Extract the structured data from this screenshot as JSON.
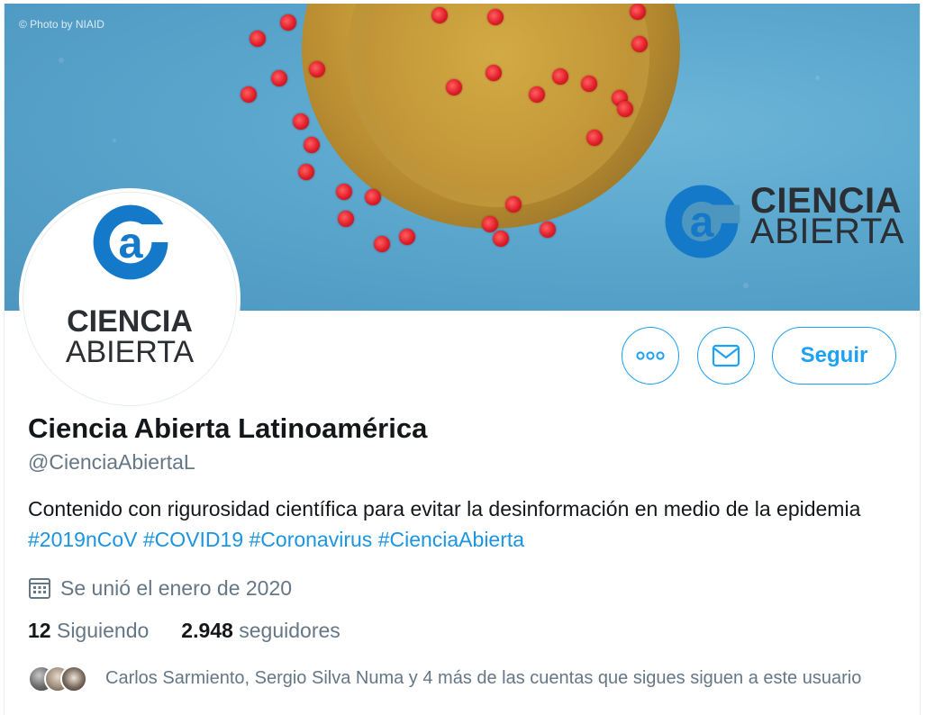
{
  "banner": {
    "credit": "© Photo by NIAID",
    "logo_line1": "CIENCIA",
    "logo_line2": "ABIERTA"
  },
  "avatar": {
    "logo_line1": "CIENCIA",
    "logo_line2": "ABIERTA"
  },
  "actions": {
    "more_icon": "more-horizontal-icon",
    "message_icon": "envelope-icon",
    "follow_label": "Seguir"
  },
  "profile": {
    "name": "Ciencia Abierta Latinoamérica",
    "handle": "@CienciaAbiertaL",
    "bio_text": "Contenido con rigurosidad científica para evitar la desinformación en medio de la epidemia",
    "hashtags": [
      "#2019nCoV",
      "#COVID19",
      "#Coronavirus",
      "#CienciaAbierta"
    ],
    "joined": "Se unió el enero de 2020",
    "following_count": "12",
    "following_label": "Siguiendo",
    "followers_count": "2.948",
    "followers_label": "seguidores",
    "followers_you_know": "Carlos Sarmiento, Sergio Silva Numa y 4 más de las cuentas que sigues siguen a este usuario"
  },
  "colors": {
    "accent": "#1da1f2",
    "link": "#1b95e0",
    "secondary_text": "#657786",
    "brand_blue": "#1579c9"
  }
}
